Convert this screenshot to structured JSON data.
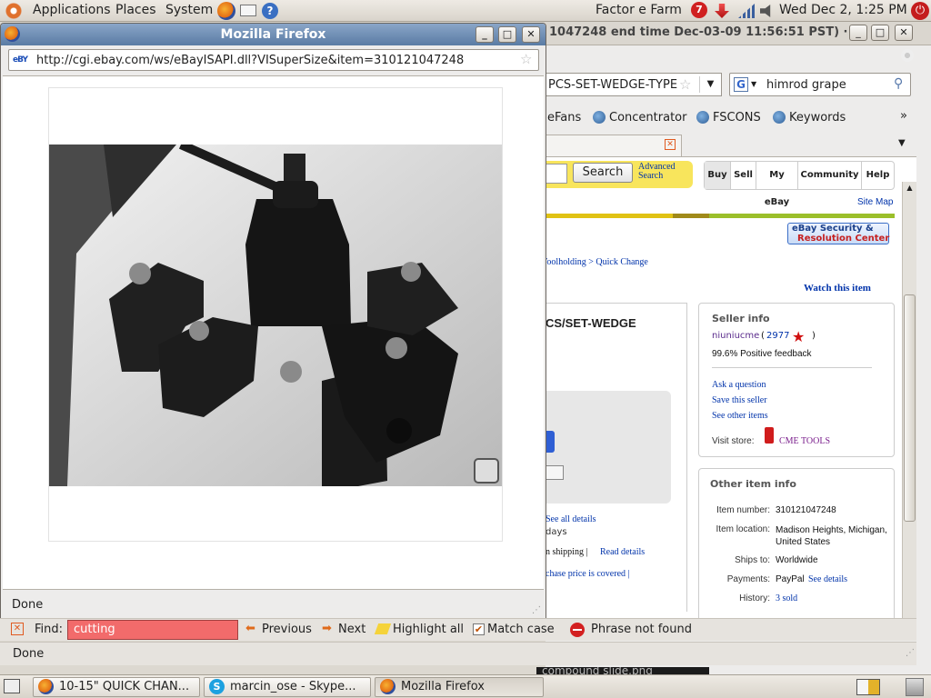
{
  "top_panel": {
    "menus": [
      "Applications",
      "Places",
      "System"
    ],
    "user": "Factor e Farm",
    "clock": "Wed Dec  2,  1:25 PM",
    "notification_count": "7"
  },
  "background_window": {
    "title": "1047248 end time Dec-03-09 11:56:51 PST) ·",
    "url_tail": "PCS-SET-WEDGE-TYPE",
    "search_value": "himrod grape",
    "bookmarks": [
      "eFans",
      "Concentrator",
      "FSCONS",
      "Keywords"
    ],
    "more_bookmarks": "»",
    "ebay": {
      "search_button": "Search",
      "advanced_search": "Advanced Search",
      "nav_tabs": [
        "Buy",
        "Sell",
        "My eBay",
        "Community",
        "Help"
      ],
      "site_map": "Site Map",
      "security_badge_line1": "eBay Security &",
      "security_badge_line2": "Resolution Center",
      "breadcrumb": "Toolholding > Quick Change",
      "watch_item": "Watch this item",
      "title_fragment": "CS/SET-WEDGE",
      "see_all_details": "See all details",
      "days_fragment": "days",
      "shipping_fragment": "n shipping |",
      "read_details": "Read details",
      "purchase_fragment": "chase price is covered |",
      "seller_info": {
        "heading": "Seller info",
        "seller": "niuniucme",
        "score": "2977",
        "feedback": "99.6% Positive feedback",
        "links": [
          "Ask a question",
          "Save this seller",
          "See other items"
        ],
        "visit_store_label": "Visit store:",
        "store_name": "CME TOOLS"
      },
      "other_item_info": {
        "heading": "Other item info",
        "rows": [
          {
            "label": "Item number:",
            "value": "310121047248"
          },
          {
            "label": "Item location:",
            "value": "Madison Heights, Michigan, United States"
          },
          {
            "label": "Ships to:",
            "value": "Worldwide"
          },
          {
            "label": "Payments:",
            "value": "PayPal",
            "link": "See details"
          },
          {
            "label": "History:",
            "value": "3 sold"
          }
        ]
      }
    }
  },
  "popup_window": {
    "title": "Mozilla Firefox",
    "url": "http://cgi.ebay.com/ws/eBayISAPI.dll?VISuperSize&item=310121047248",
    "favicon_text": "eBY",
    "status": "Done"
  },
  "find_bar": {
    "label": "Find:",
    "value": "cutting",
    "previous": "Previous",
    "next": "Next",
    "highlight_all": "Highlight all",
    "match_case": "Match case",
    "match_case_checked": true,
    "message": "Phrase not found",
    "error_color": "#f26b6b"
  },
  "status_bar": {
    "text": "Done",
    "overlay_text": "compound slide.png"
  },
  "taskbar": {
    "tasks": [
      "10-15\" QUICK CHAN...",
      "marcin_ose - Skype...",
      "Mozilla Firefox"
    ]
  },
  "colors": {
    "ebay_link": "#0033aa",
    "title_bar_active": "#6f8fb7",
    "ebay_accent_yellow": "#e0c214"
  }
}
